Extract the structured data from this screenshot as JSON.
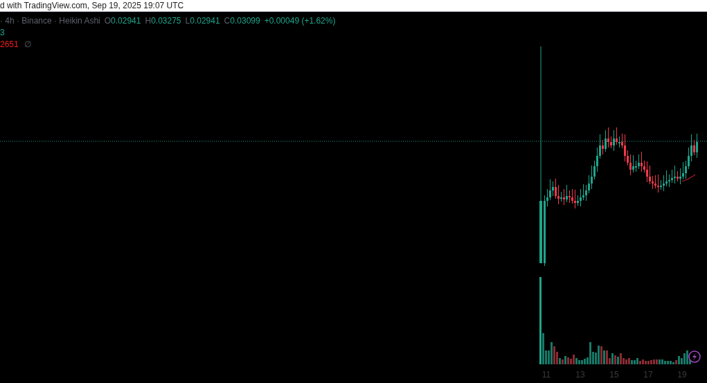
{
  "header": {
    "text": "d with TradingView.com, Sep 19, 2025 19:07 UTC"
  },
  "legend": {
    "symbol_info": "· 4h · Binance · Heikin Ashi",
    "ohlc": [
      {
        "label": "O",
        "value": "0.02941"
      },
      {
        "label": "H",
        "value": "0.03275"
      },
      {
        "label": "L",
        "value": "0.02941"
      },
      {
        "label": "C",
        "value": "0.03099"
      }
    ],
    "change": "+0.00049 (+1.62%)"
  },
  "indicators": [
    {
      "value": "3",
      "color": "#1ea58c"
    },
    {
      "value": "2651",
      "color": "#f21c1c",
      "extra": "∅"
    }
  ],
  "x_axis": {
    "labels": [
      "11",
      "13",
      "15",
      "17",
      "19"
    ]
  }
}
